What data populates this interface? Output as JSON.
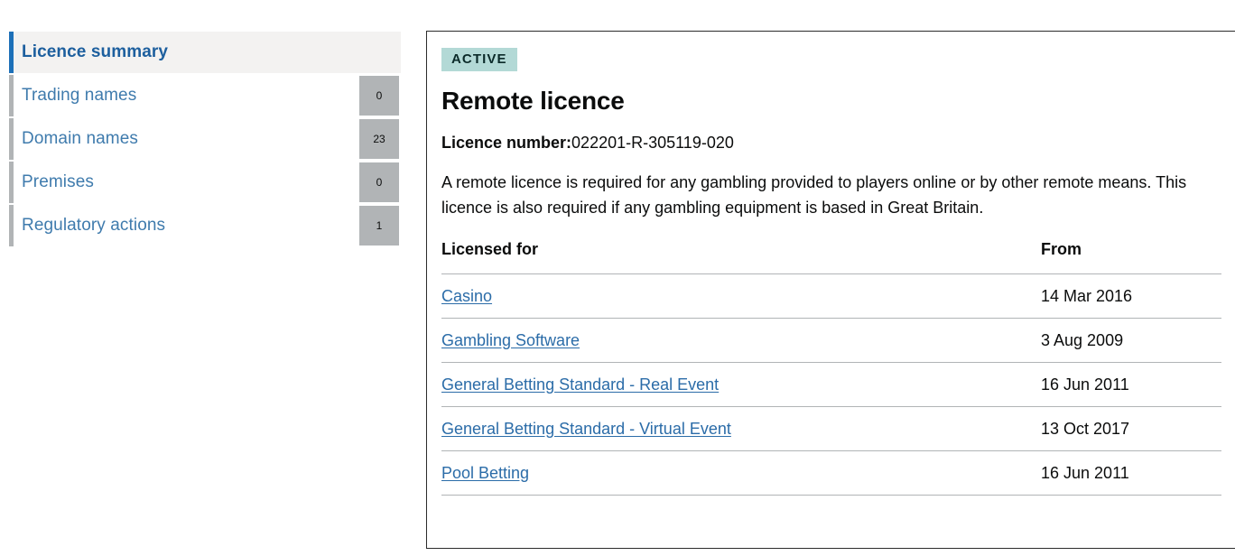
{
  "sidebar": {
    "items": [
      {
        "label": "Licence summary",
        "count": "",
        "active": true
      },
      {
        "label": "Trading names",
        "count": "0",
        "active": false
      },
      {
        "label": "Domain names",
        "count": "23",
        "active": false
      },
      {
        "label": "Premises",
        "count": "0",
        "active": false
      },
      {
        "label": "Regulatory actions",
        "count": "1",
        "active": false
      }
    ]
  },
  "panel": {
    "status_badge": "ACTIVE",
    "title": "Remote licence",
    "licence_number_label": "Licence number:",
    "licence_number_value": "022201-R-305119-020",
    "description": "A remote licence is required for any gambling provided to players online or by other remote means. This licence is also required if any gambling equipment is based in Great Britain.",
    "table": {
      "headers": [
        "Licensed for",
        "From"
      ],
      "rows": [
        {
          "name": "Casino",
          "from": "14 Mar 2016"
        },
        {
          "name": "Gambling Software",
          "from": "3 Aug 2009"
        },
        {
          "name": "General Betting Standard - Real Event",
          "from": "16 Jun 2011"
        },
        {
          "name": "General Betting Standard - Virtual Event",
          "from": "13 Oct 2017"
        },
        {
          "name": "Pool Betting",
          "from": "16 Jun 2011"
        }
      ]
    }
  },
  "colors": {
    "accent_active": "#1d70b8",
    "accent_inactive": "#b1b4b6",
    "link": "#2b6ca8",
    "badge_bg": "#b3d9d6",
    "count_bg": "#b1b4b6",
    "active_row_bg": "#f3f2f1",
    "panel_border": "#2b2b2b",
    "text": "#0b0c0c"
  }
}
